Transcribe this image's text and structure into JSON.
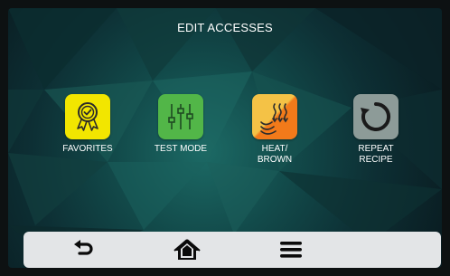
{
  "header": {
    "title": "EDIT ACCESSES"
  },
  "tiles": [
    {
      "label": "FAVORITES",
      "icon": "award-ribbon-icon",
      "color": "#f2e600"
    },
    {
      "label": "TEST MODE",
      "icon": "sliders-icon",
      "color": "#52b648"
    },
    {
      "label": "HEAT/\nBROWN",
      "icon": "heat-brown-icon",
      "color": "#f39a2c"
    },
    {
      "label": "REPEAT\nRECIPE",
      "icon": "repeat-icon",
      "color": "#8d9b98"
    }
  ],
  "navbar": {
    "back_icon": "back-icon",
    "home_icon": "home-icon",
    "menu_icon": "menu-icon"
  }
}
